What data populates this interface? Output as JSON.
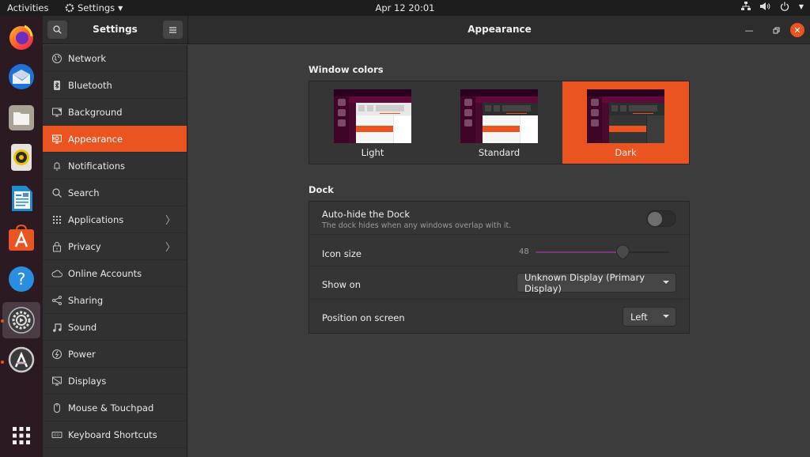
{
  "topbar": {
    "activities": "Activities",
    "app_menu": "Settings",
    "clock": "Apr 12  20:01",
    "tray": [
      "network-icon",
      "volume-icon",
      "power-icon",
      "menu-arrow-icon"
    ]
  },
  "dock": {
    "items": [
      {
        "name": "Firefox",
        "icon": "firefox-icon"
      },
      {
        "name": "Thunderbird",
        "icon": "thunderbird-icon"
      },
      {
        "name": "Files",
        "icon": "files-icon"
      },
      {
        "name": "Rhythmbox",
        "icon": "rhythmbox-icon"
      },
      {
        "name": "LibreOffice Writer",
        "icon": "writer-icon"
      },
      {
        "name": "Ubuntu Software",
        "icon": "software-icon"
      },
      {
        "name": "Help",
        "icon": "help-icon"
      },
      {
        "name": "Settings",
        "icon": "settings-icon",
        "active": true,
        "running": true
      },
      {
        "name": "Software Updater",
        "icon": "updater-icon",
        "running": true
      }
    ],
    "show_apps": "show-applications-icon"
  },
  "window": {
    "sidebar_title": "Settings",
    "page_title": "Appearance",
    "brand_color": "#e95420"
  },
  "sidebar": {
    "items": [
      {
        "label": "Network",
        "icon": "network-icon"
      },
      {
        "label": "Bluetooth",
        "icon": "bluetooth-icon"
      },
      {
        "label": "Background",
        "icon": "background-icon"
      },
      {
        "label": "Appearance",
        "icon": "appearance-icon",
        "selected": true
      },
      {
        "label": "Notifications",
        "icon": "bell-icon"
      },
      {
        "label": "Search",
        "icon": "search-icon"
      },
      {
        "label": "Applications",
        "icon": "grid-icon",
        "chevron": true
      },
      {
        "label": "Privacy",
        "icon": "lock-icon",
        "chevron": true
      },
      {
        "label": "Online Accounts",
        "icon": "cloud-icon"
      },
      {
        "label": "Sharing",
        "icon": "share-icon"
      },
      {
        "label": "Sound",
        "icon": "music-note-icon"
      },
      {
        "label": "Power",
        "icon": "power-icon"
      },
      {
        "label": "Displays",
        "icon": "display-icon"
      },
      {
        "label": "Mouse & Touchpad",
        "icon": "mouse-icon"
      },
      {
        "label": "Keyboard Shortcuts",
        "icon": "keyboard-icon"
      }
    ]
  },
  "appearance": {
    "window_colors_title": "Window colors",
    "options": [
      {
        "label": "Light",
        "selected": false
      },
      {
        "label": "Standard",
        "selected": false
      },
      {
        "label": "Dark",
        "selected": true
      }
    ],
    "dock_title": "Dock",
    "autohide": {
      "label": "Auto-hide the Dock",
      "description": "The dock hides when any windows overlap with it.",
      "enabled": false
    },
    "icon_size": {
      "label": "Icon size",
      "value": 48,
      "min": 16,
      "max": 64
    },
    "show_on": {
      "label": "Show on",
      "value": "Unknown Display (Primary Display)"
    },
    "position": {
      "label": "Position on screen",
      "value": "Left"
    }
  }
}
